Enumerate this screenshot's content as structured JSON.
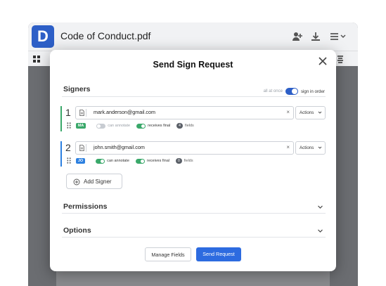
{
  "app": {
    "logo_letter": "D",
    "doc_title": "Code of Conduct.pdf"
  },
  "modal": {
    "title": "Send Sign Request",
    "signers_heading": "Signers",
    "order": {
      "all_at_once": "all at once",
      "sign_in_order": "sign in order",
      "sign_in_order_enabled": true
    },
    "signers": [
      {
        "number": "1",
        "email": "mark.anderson@gmail.com",
        "initials": "MA",
        "actions_label": "Actions",
        "can_annotate_label": "can annotate",
        "can_annotate": false,
        "receives_final_label": "receives final",
        "receives_final": true,
        "field_count": "4",
        "fields_label": "fields",
        "color": "#3aa86a",
        "badge_bg": "#3aa86a",
        "badge_fg": "#ffffff"
      },
      {
        "number": "2",
        "email": "john.smith@gmail.com",
        "initials": "JO",
        "actions_label": "Actions",
        "can_annotate_label": "can annotate",
        "can_annotate": true,
        "receives_final_label": "receives final",
        "receives_final": true,
        "field_count": "0",
        "fields_label": "fields",
        "color": "#2d80e0",
        "badge_bg": "#2d80e0",
        "badge_fg": "#ffffff"
      }
    ],
    "add_signer_label": "Add Signer",
    "permissions_heading": "Permissions",
    "options_heading": "Options",
    "manage_fields_label": "Manage Fields",
    "send_request_label": "Send Request"
  }
}
